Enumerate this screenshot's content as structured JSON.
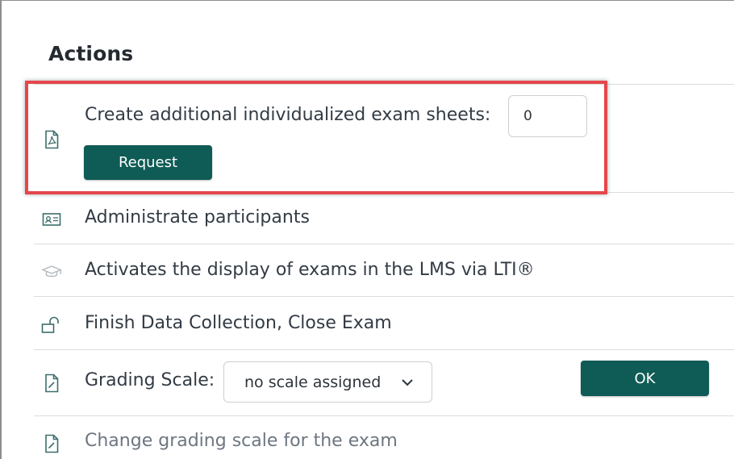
{
  "section_title": "Actions",
  "exam_sheets": {
    "label": "Create additional individualized exam sheets:",
    "value": "0",
    "button_label": "Request"
  },
  "rows": {
    "administrate": "Administrate participants",
    "lti": "Activates the display of exams in the LMS via LTI®",
    "finish": "Finish Data Collection, Close Exam",
    "change_scale": "Change grading scale for the exam"
  },
  "grading": {
    "label": "Grading Scale:",
    "selected_option": "no scale assigned",
    "ok_label": "OK"
  },
  "icons": [
    "pdf-file-icon",
    "id-card-icon",
    "graduation-cap-icon",
    "unlock-icon",
    "edit-document-icon"
  ],
  "colors": {
    "button_bg": "#0f5b55",
    "highlight_border": "#e4474c"
  }
}
